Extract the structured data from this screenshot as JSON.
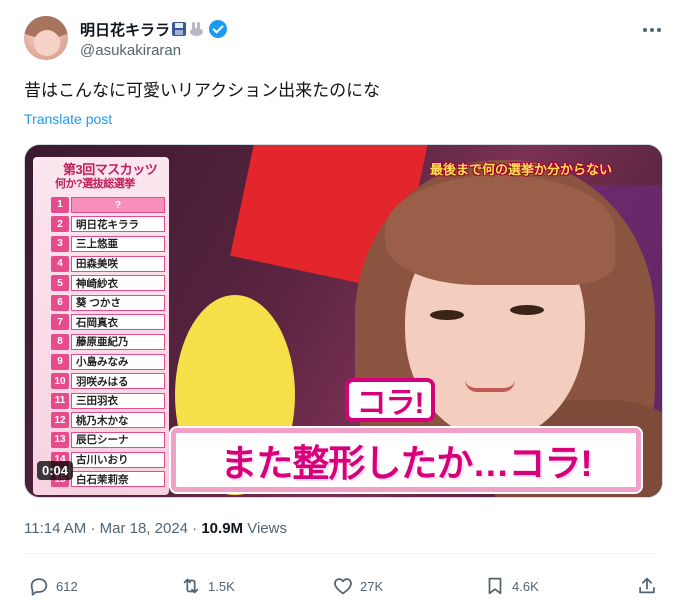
{
  "author": {
    "display_name": "明日花キララ",
    "handle": "@asukakiraran",
    "badges": [
      "floppy-disk-icon",
      "rabbit-icon",
      "verified-icon"
    ]
  },
  "tweet": {
    "text": "昔はこんなに可愛いリアクション出来たのにな",
    "translate_label": "Translate post"
  },
  "media": {
    "duration": "0:04",
    "ranking": {
      "title_line1": "第3回マスカッツ",
      "title_line2": "何か?選抜総選挙",
      "entries": [
        {
          "rank": "1",
          "name": "?"
        },
        {
          "rank": "2",
          "name": "明日花キララ"
        },
        {
          "rank": "3",
          "name": "三上悠亜"
        },
        {
          "rank": "4",
          "name": "田森美咲"
        },
        {
          "rank": "5",
          "name": "神崎紗衣"
        },
        {
          "rank": "6",
          "name": "葵 つかさ"
        },
        {
          "rank": "7",
          "name": "石岡真衣"
        },
        {
          "rank": "8",
          "name": "藤原亜紀乃"
        },
        {
          "rank": "9",
          "name": "小島みなみ"
        },
        {
          "rank": "10",
          "name": "羽咲みはる"
        },
        {
          "rank": "11",
          "name": "三田羽衣"
        },
        {
          "rank": "12",
          "name": "桃乃木かな"
        },
        {
          "rank": "13",
          "name": "辰巳シーナ"
        },
        {
          "rank": "14",
          "name": "古川いおり"
        },
        {
          "rank": "15",
          "name": "白石茉莉奈"
        }
      ]
    },
    "top_caption": "最後まで何の選挙か分からない",
    "kora_small": "コラ!",
    "main_caption": "また整形したか…コラ!"
  },
  "meta": {
    "time": "11:14 AM",
    "separator": "·",
    "date": "Mar 18, 2024",
    "views_count": "10.9M",
    "views_label": "Views"
  },
  "actions": {
    "replies": "612",
    "reposts": "1.5K",
    "likes": "27K",
    "bookmarks": "4.6K"
  },
  "colors": {
    "accent": "#1d9bf0",
    "text": "#0f1419",
    "secondary": "#536471",
    "caption_pink": "#d8007a"
  }
}
